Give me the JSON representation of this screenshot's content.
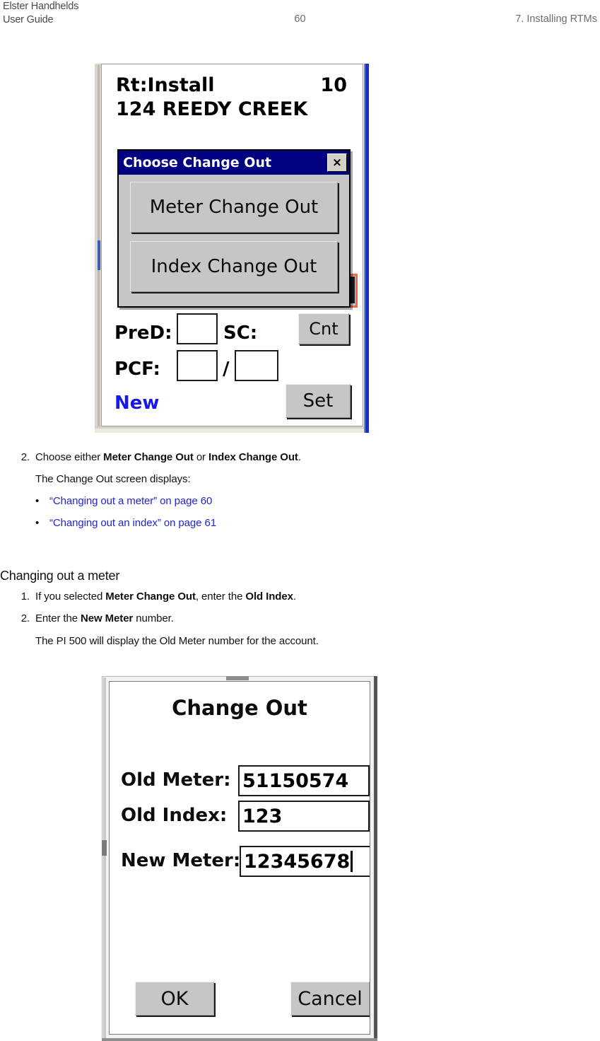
{
  "header": {
    "left_line1": "Elster Handhelds",
    "left_line2": "User Guide",
    "page_number": "60",
    "right": "7. Installing RTMs"
  },
  "figure1": {
    "alt": "Choose Change Out dialog on handheld",
    "screen": {
      "route_label": "Rt:Install",
      "route_number": "10",
      "address": "124 REEDY CREEK",
      "pred_label": "PreD:",
      "sc_label": "SC:",
      "pcf_label": "PCF:",
      "slash": "/",
      "new_label": "New",
      "pred_value": "",
      "pcf_value_1": "",
      "pcf_value_2": "",
      "cnt_button": "Cnt",
      "set_button": "Set"
    },
    "dialog": {
      "title": "Choose Change Out",
      "close_glyph": "×",
      "button_1": "Meter Change Out",
      "button_2": "Index Change Out"
    },
    "colors": {
      "titlebar": "#000080",
      "dialog_face": "#c6c6c6",
      "highlight": "#ff6347",
      "device_accent": "#1831c8",
      "new_text": "#1818e8"
    }
  },
  "step_list_1": {
    "item2": {
      "number": "2.",
      "prefix": "Choose either ",
      "bold1": "Meter Change Out",
      "middle": " or ",
      "bold2": "Index Change Out",
      "suffix": "."
    },
    "continuation": "The Change Out screen displays:",
    "bullets": [
      {
        "text": "“Changing out a meter” on page 60"
      },
      {
        "text": "“Changing out an index” on page 61"
      }
    ]
  },
  "section": {
    "heading": "Changing out a meter",
    "items": [
      {
        "number": "1.",
        "prefix": "If you selected ",
        "bold1": "Meter Change Out",
        "middle": ", enter the ",
        "bold2": "Old Index",
        "suffix": "."
      },
      {
        "number": "2.",
        "prefix": "Enter the ",
        "bold1": "New Meter",
        "middle": " number.",
        "bold2": "",
        "suffix": ""
      }
    ],
    "continuation": "The PI 500 will display the Old Meter number for the account."
  },
  "figure2": {
    "alt": "Change Out entry screen",
    "title": "Change Out",
    "fields": [
      {
        "label": "Old Meter:",
        "value": "51150574",
        "focused": false
      },
      {
        "label": "Old Index:",
        "value": "123",
        "focused": false
      },
      {
        "label": "New Meter:",
        "value": "12345678",
        "focused": true
      }
    ],
    "ok_button": "OK",
    "cancel_button": "Cancel"
  }
}
